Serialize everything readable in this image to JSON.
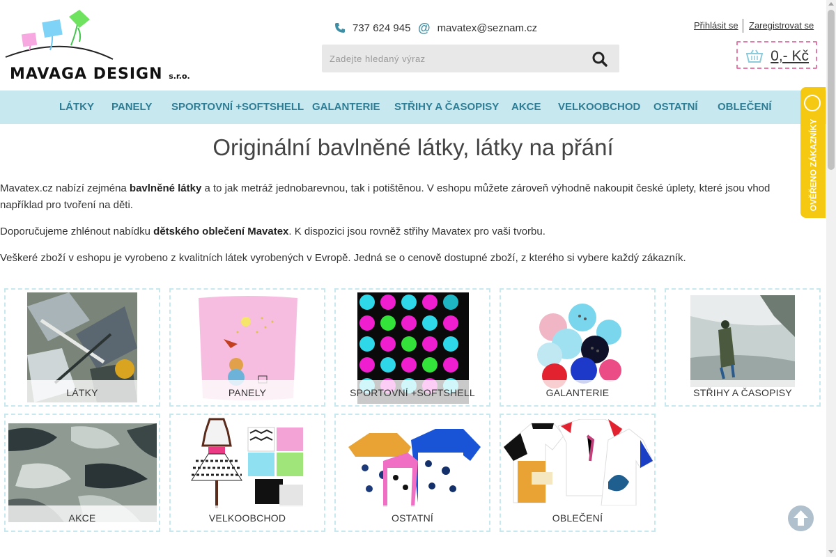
{
  "brand": {
    "name": "MAVAGA DESIGN",
    "suffix": "s.r.o."
  },
  "contact": {
    "phone": "737 624 945",
    "phone_icon": "phone-icon",
    "email": "mavatex@seznam.cz",
    "email_icon": "at-icon"
  },
  "search": {
    "placeholder": "Zadejte hledaný výraz",
    "button_icon": "search-icon"
  },
  "auth": {
    "login": "Přihlásit se",
    "register": "Zaregistrovat se"
  },
  "cart": {
    "icon": "basket-icon",
    "total": "0,- Kč"
  },
  "nav": {
    "items": [
      {
        "label": "LÁTKY"
      },
      {
        "label": "PANELY"
      },
      {
        "label": "SPORTOVNÍ +SOFTSHELL"
      },
      {
        "label": "GALANTERIE"
      },
      {
        "label": "STŘIHY A ČASOPISY"
      },
      {
        "label": "AKCE"
      },
      {
        "label": "VELKOOBCHOD"
      },
      {
        "label": "OSTATNÍ"
      },
      {
        "label": "OBLEČENÍ"
      }
    ]
  },
  "badge": {
    "text": "OVĚŘENO ZÁKAZNÍKY"
  },
  "main": {
    "title": "Originální bavlněné látky, látky na přání",
    "p1": {
      "t1": "Mavatex.cz nabízí zejména ",
      "b1": "bavlněné látky",
      "t2": " a to jak metráž jednobarevnou, tak i potištěnou. V eshopu můžete zároveň výhodně nakoupit české úplety, které jsou vhod",
      "t3": "například pro tvoření na děti."
    },
    "p2": {
      "t1": "Doporučujeme zhlénout nabídku ",
      "b1": "dětského oblečení Mavatex",
      "t2": ". K dispozici jsou rovněž střihy Mavatex pro vaši tvorbu."
    },
    "p3": "Veškeré zboží v eshopu je vyrobeno z kvalitních látek vyrobených v Evropě. Jedná se o cenově dostupné zboží, z kterého si vybere každý zákazník."
  },
  "categories": [
    {
      "label": "LÁTKY"
    },
    {
      "label": "PANELY"
    },
    {
      "label": "SPORTOVNÍ +SOFTSHELL"
    },
    {
      "label": "GALANTERIE"
    },
    {
      "label": "STŘIHY A ČASOPISY"
    },
    {
      "label": "AKCE"
    },
    {
      "label": "VELKOOBCHOD"
    },
    {
      "label": "OSTATNÍ"
    },
    {
      "label": "OBLEČENÍ"
    }
  ],
  "colors": {
    "nav_bg": "#c7e8ef",
    "nav_text": "#2e7d95",
    "cart_border": "#e27ba7",
    "badge_bg": "#f5c812"
  }
}
